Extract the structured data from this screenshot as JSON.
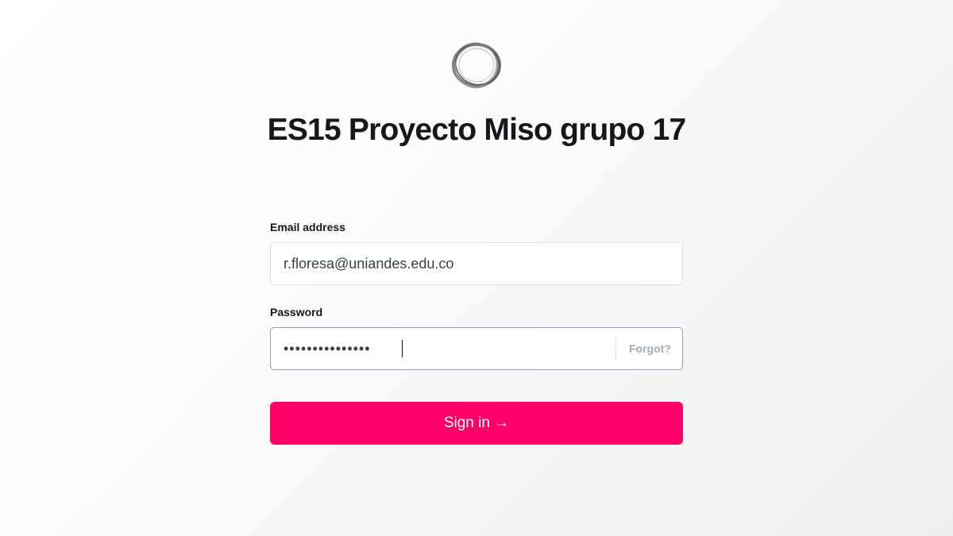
{
  "site": {
    "title": "ES15 Proyecto Miso grupo 17"
  },
  "icons": {
    "logo": "ring-logo-icon"
  },
  "form": {
    "email_label": "Email address",
    "email_value": "r.floresa@uniandes.edu.co",
    "password_label": "Password",
    "password_value": "•••••••••••••••",
    "forgot_label": "Forgot?",
    "signin_label": "Sign in →"
  },
  "colors": {
    "accent": "#ff0066",
    "text": "#15171a",
    "muted": "#a3adb8"
  }
}
